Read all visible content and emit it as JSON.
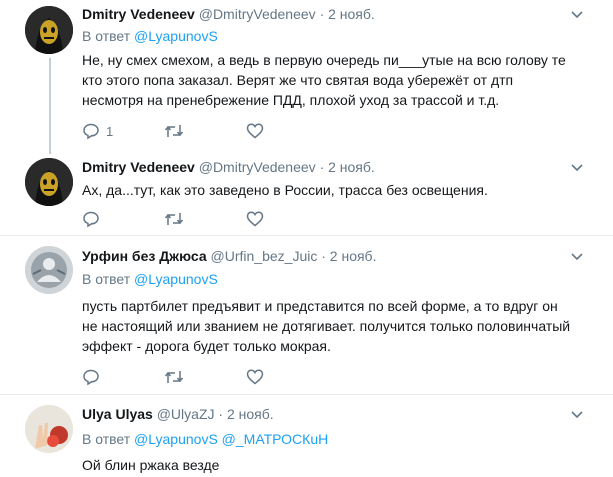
{
  "tweets": [
    {
      "name": "Dmitry Vedeneev",
      "handle": "@DmitryVedeneev",
      "date": "· 2 нояб.",
      "reply_prefix": "В ответ",
      "reply_to": "@LyapunovS",
      "text": "Не, ну смех смехом, а ведь в первую очередь пи___утые на всю голову те кто этого попа заказал. Верят же что святая вода убережёт от дтп несмотря на пренебрежение ПДД, плохой уход за трассой и т.д.",
      "reply_count": "1"
    },
    {
      "name": "Dmitry Vedeneev",
      "handle": "@DmitryVedeneev",
      "date": "· 2 нояб.",
      "text": "Ах, да...тут, как это заведено в России, трасса без освещения."
    },
    {
      "name": "Урфин без Джюса",
      "handle": "@Urfin_bez_Juic",
      "date": "· 2 нояб.",
      "reply_prefix": "В ответ",
      "reply_to": "@LyapunovS",
      "text": "пусть партбилет предъявит и представится по всей форме, а то вдруг он не настоящий или званием не дотягивает. получится только половинчатый эффект - дорога будет только мокрая."
    },
    {
      "name": "Ulya Ulyas",
      "handle": "@UlyaZJ",
      "date": "· 2 нояб.",
      "reply_prefix": "В ответ",
      "reply_to": "@LyapunovS",
      "reply_to_2": "@_МАТРОСКuH",
      "text": "Ой блин ржака везде"
    }
  ],
  "colors": {
    "accent": "#1da1f2",
    "muted": "#657786",
    "thread": "#c4cfd6"
  }
}
